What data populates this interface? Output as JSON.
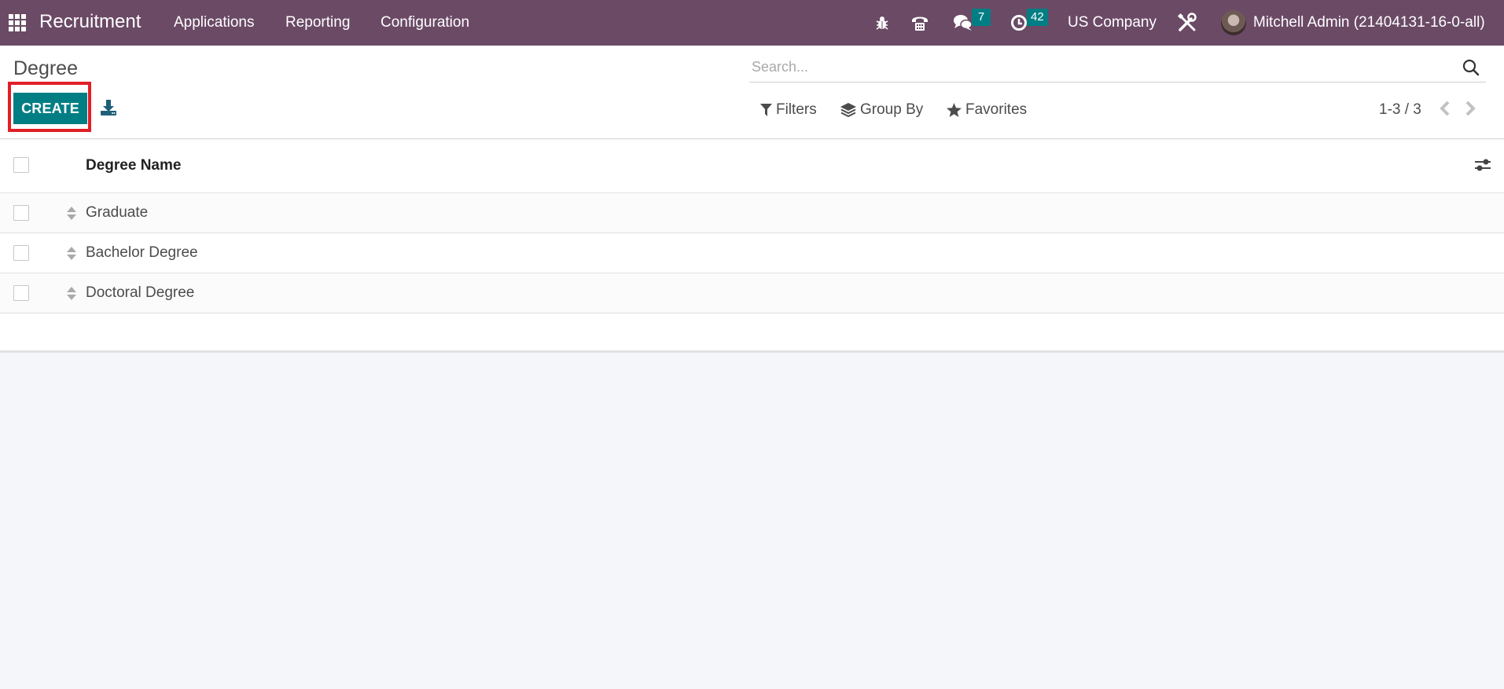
{
  "navbar": {
    "app_name": "Recruitment",
    "menu": [
      {
        "label": "Applications"
      },
      {
        "label": "Reporting"
      },
      {
        "label": "Configuration"
      }
    ],
    "icons": {
      "apps": "apps-grid-icon",
      "debug": "bug-icon",
      "voip": "phone-icon",
      "messages": "chat-icon",
      "activities": "clock-icon",
      "settings": "tools-icon"
    },
    "messages_count": "7",
    "activities_count": "42",
    "company": "US Company",
    "user": "Mitchell Admin (21404131-16-0-all)"
  },
  "control_panel": {
    "breadcrumb": "Degree",
    "create_label": "CREATE",
    "search_placeholder": "Search...",
    "filters_label": "Filters",
    "group_by_label": "Group By",
    "favorites_label": "Favorites",
    "pager": "1-3 / 3"
  },
  "list": {
    "column": "Degree Name",
    "rows": [
      {
        "name": "Graduate"
      },
      {
        "name": "Bachelor Degree"
      },
      {
        "name": "Doctoral Degree"
      }
    ]
  },
  "colors": {
    "navbar": "#6b4a66",
    "primary": "#017e84",
    "highlight": "#e11f26",
    "background": "#f5f6fa"
  }
}
